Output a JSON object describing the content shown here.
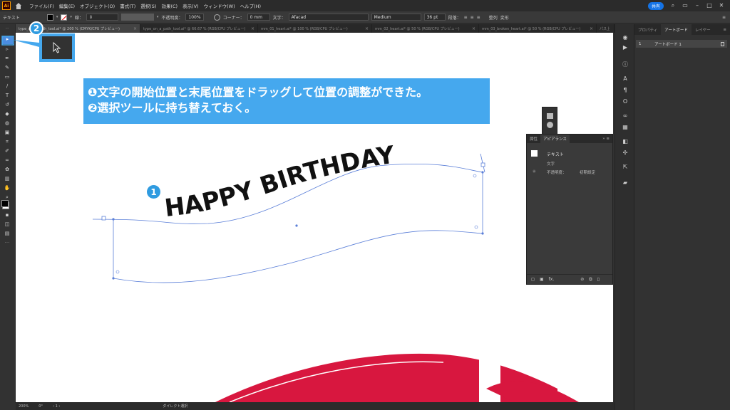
{
  "app": {
    "logo": "Ai",
    "menus": [
      "ファイル(F)",
      "編集(E)",
      "オブジェクト(O)",
      "書式(T)",
      "選択(S)",
      "効果(C)",
      "表示(V)",
      "ウィンドウ(W)",
      "ヘルプ(H)"
    ],
    "share_label": "共有"
  },
  "control_bar": {
    "mode_label": "テキスト",
    "stroke_label": "線：",
    "opacity_label": "不透明度：",
    "opacity_value": "100%",
    "corner_label": "コーナー：",
    "corner_value": "0 mm",
    "char_label": "文字：",
    "font_name": "Afacad",
    "font_style": "Medium",
    "font_size": "36 pt",
    "paragraph_label": "段落：",
    "transform_label": "整列",
    "warp_label": "変形"
  },
  "tabs": [
    {
      "label": "type_on_a_path_tool.ai* @ 200 % (CMYK/CPU プレビュー)",
      "active": true
    },
    {
      "label": "type_on_a_path_tool.ai* @ 66.67 % (RGB/CPU プレビュー)",
      "active": false
    },
    {
      "label": "mm_01_heart.ai* @ 100 % (RGB/CPU プレビュー)",
      "active": false
    },
    {
      "label": "mm_02_heart.ai* @ 50 % (RGB/CPU プレビュー)",
      "active": false
    },
    {
      "label": "mm_03_broken_heart.ai* @ 50 % (RGB/CPU プレビュー)",
      "active": false
    },
    {
      "label": "パス上文字ツール.ai* @ 200 % (RGB/CPU プレビュー)",
      "active": false
    }
  ],
  "instructions": {
    "line1": "❶文字の開始位置と末尾位置をドラッグして位置の調整ができた。",
    "line2": "❷選択ツールに持ち替えておく。"
  },
  "badges": {
    "one": "1",
    "two": "2"
  },
  "artwork": {
    "path_text": "HAPPY BIRTHDAY",
    "ribbon_color": "#d8173f"
  },
  "appearance_panel": {
    "tab_attributes": "属性",
    "tab_appearance": "アピアランス",
    "object_label": "テキスト",
    "char_row": "文字",
    "opacity_label": "不透明度：",
    "opacity_value": "初期設定",
    "fx": "fx."
  },
  "right_panel": {
    "tabs": [
      "プロパティ",
      "アートボード",
      "レイヤー"
    ],
    "artboard_number": "1",
    "artboard_name": "アートボード 1"
  },
  "status_bar": {
    "zoom": "200%",
    "rotation": "0°",
    "page": "1",
    "tool_name": "ダイレクト選択"
  },
  "colors": {
    "accent": "#45a8ee",
    "badge": "#2f9be0",
    "selection": "#4b8de0",
    "path": "#5b7fd8"
  }
}
